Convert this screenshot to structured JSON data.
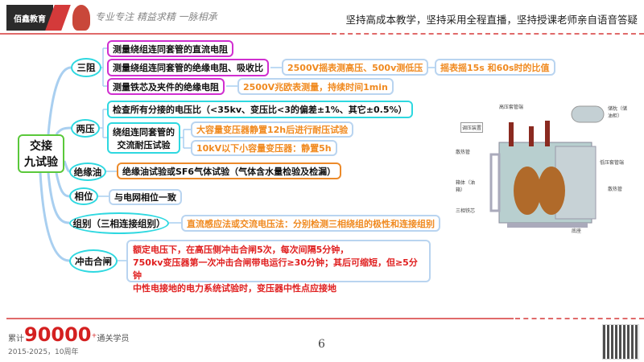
{
  "header": {
    "logo": "佰鑫教育",
    "motto": "专业专注 精益求精 一脉相承",
    "tagline": "坚持高成本教学，坚持采用全程直播，坚持授课老师亲自语音答疑"
  },
  "center": {
    "line1": "交接",
    "line2": "九试验"
  },
  "branches": {
    "sanzu": {
      "label": "三阻",
      "items": [
        "测量绕组连同套管的直流电阻",
        "测量绕组连同套管的绝缘电阻、吸收比",
        "测量铁芯及夹件的绝缘电阻"
      ],
      "notes": [
        "2500V摇表测高压、500v测低压",
        "摇表摇15s 和60s时的比值",
        "2500V兆欧表测量，持续时间1min"
      ]
    },
    "liangya": {
      "label": "两压",
      "items": [
        "检查所有分接的电压比（<35kv、变压比<3的偏差±1%、其它±0.5%）",
        "绕组连同套管的",
        "交流耐压试验"
      ],
      "notes": [
        "大容量变压器静置12h后进行耐压试验",
        "10kV以下小容量变压器：静置5h"
      ]
    },
    "oil": {
      "label": "绝缘油",
      "item": "绝缘油试验或SF6气体试验（气体含水量检验及检漏）"
    },
    "phase": {
      "label": "相位",
      "item": "与电网相位一致"
    },
    "group": {
      "label": "组别（三相连接组别）",
      "item": "直流感应法或交流电压法：分别检测三相绕组的极性和连接组别"
    },
    "impact": {
      "label": "冲击合闸",
      "lines": [
        "额定电压下，在高压侧冲击合闸5次，每次间隔5分钟，",
        "750kv变压器第一次冲击合闸带电运行≥30分钟；其后可缩短，但≥5分钟",
        "中性电接地的电力系统试验时，变压器中性点应接地"
      ]
    }
  },
  "diagram": {
    "labels": [
      "高压套管端",
      "储枕（储油柜）",
      "调压装置",
      "散热管",
      "箱体（油箱）",
      "三相铁芯",
      "低压套管端",
      "散热管",
      "底座"
    ]
  },
  "footer": {
    "prefix": "累计",
    "count": "90000",
    "plus": "+",
    "suffix": "通关学员",
    "years": "2015-2025，10周年",
    "page": "6"
  }
}
